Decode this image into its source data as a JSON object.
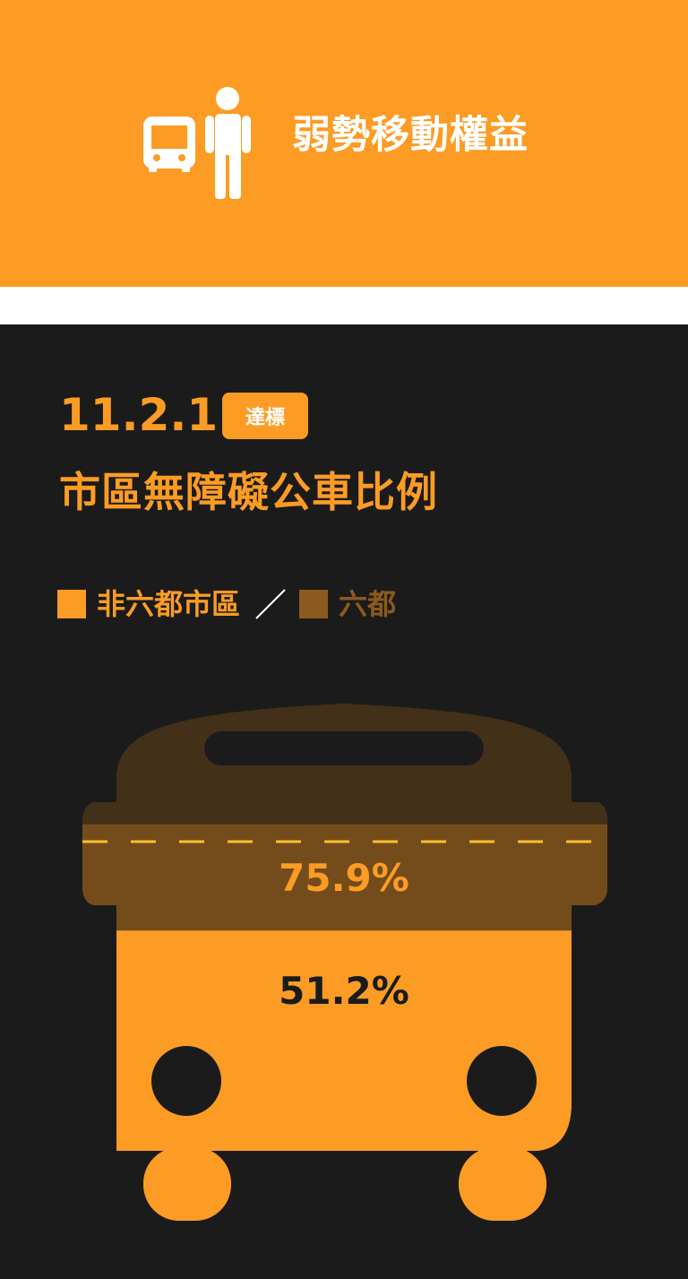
{
  "header": {
    "title": "弱勢移動權益",
    "icons": [
      "bus-icon",
      "person-icon"
    ],
    "background": "#fc9c24"
  },
  "indicator": {
    "code": "11.2.1",
    "status": "達標",
    "title": "市區無障礙公車比例"
  },
  "legend": {
    "items": [
      {
        "label": "非六都市區",
        "color": "#fc9c24"
      },
      {
        "label": "六都",
        "color": "#8c5a1e"
      }
    ],
    "separator": "／"
  },
  "chart_data": {
    "type": "bar",
    "categories": [
      "非六都市區",
      "六都"
    ],
    "values": [
      51.2,
      75.9
    ],
    "value_labels": [
      "51.2%",
      "75.9%"
    ],
    "unit": "%",
    "ylim": [
      0,
      100
    ],
    "colors": [
      "#fc9c24",
      "#744c1c"
    ],
    "target_line": "dashed"
  }
}
